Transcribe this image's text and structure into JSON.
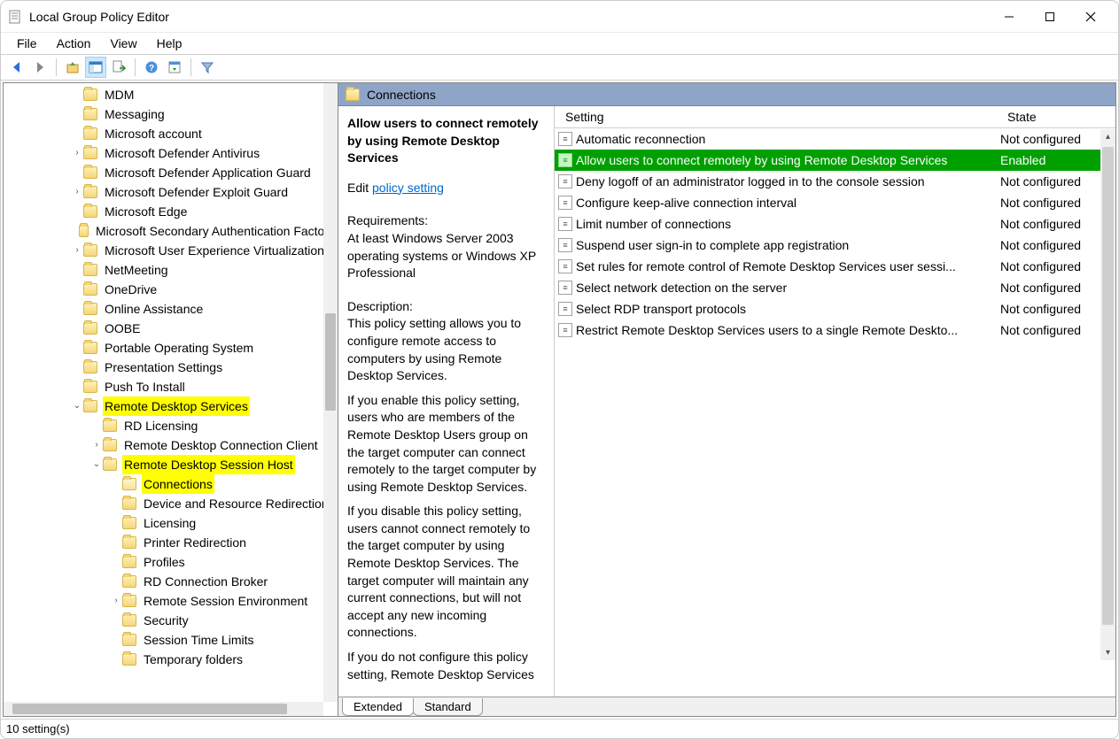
{
  "window": {
    "title": "Local Group Policy Editor"
  },
  "menu": {
    "file": "File",
    "action": "Action",
    "view": "View",
    "help": "Help"
  },
  "tree": {
    "items": [
      {
        "indent": 3,
        "expander": "",
        "label": "MDM"
      },
      {
        "indent": 3,
        "expander": "",
        "label": "Messaging"
      },
      {
        "indent": 3,
        "expander": "",
        "label": "Microsoft account"
      },
      {
        "indent": 3,
        "expander": "›",
        "label": "Microsoft Defender Antivirus"
      },
      {
        "indent": 3,
        "expander": "",
        "label": "Microsoft Defender Application Guard"
      },
      {
        "indent": 3,
        "expander": "›",
        "label": "Microsoft Defender Exploit Guard"
      },
      {
        "indent": 3,
        "expander": "",
        "label": "Microsoft Edge"
      },
      {
        "indent": 3,
        "expander": "",
        "label": "Microsoft Secondary Authentication Factor"
      },
      {
        "indent": 3,
        "expander": "›",
        "label": "Microsoft User Experience Virtualization"
      },
      {
        "indent": 3,
        "expander": "",
        "label": "NetMeeting"
      },
      {
        "indent": 3,
        "expander": "",
        "label": "OneDrive"
      },
      {
        "indent": 3,
        "expander": "",
        "label": "Online Assistance"
      },
      {
        "indent": 3,
        "expander": "",
        "label": "OOBE"
      },
      {
        "indent": 3,
        "expander": "",
        "label": "Portable Operating System"
      },
      {
        "indent": 3,
        "expander": "",
        "label": "Presentation Settings"
      },
      {
        "indent": 3,
        "expander": "",
        "label": "Push To Install"
      },
      {
        "indent": 3,
        "expander": "⌄",
        "label": "Remote Desktop Services",
        "hl": true
      },
      {
        "indent": 4,
        "expander": "",
        "label": "RD Licensing"
      },
      {
        "indent": 4,
        "expander": "›",
        "label": "Remote Desktop Connection Client"
      },
      {
        "indent": 4,
        "expander": "⌄",
        "label": "Remote Desktop Session Host",
        "hl": true
      },
      {
        "indent": 5,
        "expander": "",
        "label": "Connections",
        "hl": true,
        "open": true
      },
      {
        "indent": 5,
        "expander": "",
        "label": "Device and Resource Redirection"
      },
      {
        "indent": 5,
        "expander": "",
        "label": "Licensing"
      },
      {
        "indent": 5,
        "expander": "",
        "label": "Printer Redirection"
      },
      {
        "indent": 5,
        "expander": "",
        "label": "Profiles"
      },
      {
        "indent": 5,
        "expander": "",
        "label": "RD Connection Broker"
      },
      {
        "indent": 5,
        "expander": "›",
        "label": "Remote Session Environment"
      },
      {
        "indent": 5,
        "expander": "",
        "label": "Security"
      },
      {
        "indent": 5,
        "expander": "",
        "label": "Session Time Limits"
      },
      {
        "indent": 5,
        "expander": "",
        "label": "Temporary folders"
      }
    ]
  },
  "content": {
    "header": "Connections",
    "setting_title": "Allow users to connect remotely by using Remote Desktop Services",
    "edit_prefix": "Edit ",
    "edit_link": "policy setting",
    "requirements_label": "Requirements:",
    "requirements_text": "At least Windows Server 2003 operating systems or Windows XP Professional",
    "description_label": "Description:",
    "description_p1": "This policy setting allows you to configure remote access to computers by using Remote Desktop Services.",
    "description_p2": "If you enable this policy setting, users who are members of the Remote Desktop Users group on the target computer can connect remotely to the target computer by using Remote Desktop Services.",
    "description_p3": "If you disable this policy setting, users cannot connect remotely to the target computer by using Remote Desktop Services. The target computer will maintain any current connections, but will not accept any new incoming connections.",
    "description_p4": "If you do not configure this policy setting, Remote Desktop Services"
  },
  "list": {
    "col_setting": "Setting",
    "col_state": "State",
    "rows": [
      {
        "setting": "Automatic reconnection",
        "state": "Not configured"
      },
      {
        "setting": "Allow users to connect remotely by using Remote Desktop Services",
        "state": "Enabled",
        "selected": true
      },
      {
        "setting": "Deny logoff of an administrator logged in to the console session",
        "state": "Not configured"
      },
      {
        "setting": "Configure keep-alive connection interval",
        "state": "Not configured"
      },
      {
        "setting": "Limit number of connections",
        "state": "Not configured"
      },
      {
        "setting": "Suspend user sign-in to complete app registration",
        "state": "Not configured"
      },
      {
        "setting": "Set rules for remote control of Remote Desktop Services user sessi...",
        "state": "Not configured"
      },
      {
        "setting": "Select network detection on the server",
        "state": "Not configured"
      },
      {
        "setting": "Select RDP transport protocols",
        "state": "Not configured"
      },
      {
        "setting": "Restrict Remote Desktop Services users to a single Remote Deskto...",
        "state": "Not configured"
      }
    ]
  },
  "tabs": {
    "extended": "Extended",
    "standard": "Standard"
  },
  "status": {
    "text": "10 setting(s)"
  }
}
